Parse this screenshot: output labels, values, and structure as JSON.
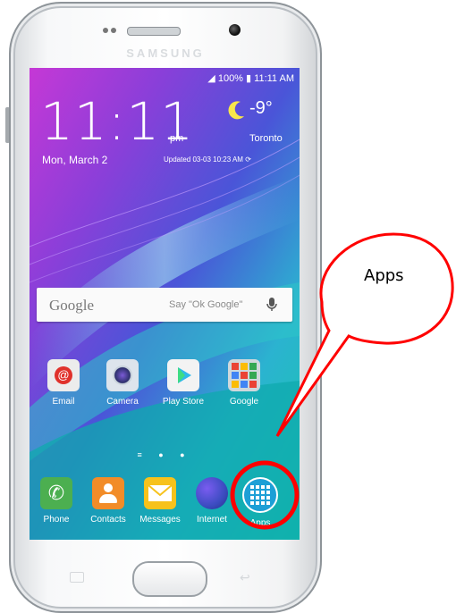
{
  "device": {
    "brand": "SAMSUNG"
  },
  "status_bar": {
    "battery": "100%",
    "time": "11:11 AM"
  },
  "lock_widget": {
    "time": "11:11",
    "ampm": "pm",
    "date": "Mon, March 2",
    "temperature": "-9°",
    "city": "Toronto",
    "updated": "Updated 03-03 10:23 AM"
  },
  "google_bar": {
    "logo": "Google",
    "hint": "Say \"Ok Google\""
  },
  "apps": [
    {
      "label": "Email",
      "icon": "email-icon",
      "color": "#e8e8e8"
    },
    {
      "label": "Camera",
      "icon": "camera-icon",
      "color": "#dfe6ee"
    },
    {
      "label": "Play Store",
      "icon": "play-store-icon",
      "color": "#f2f2f2"
    },
    {
      "label": "Google",
      "icon": "google-folder-icon",
      "color": "#cfd8dc"
    }
  ],
  "dock": [
    {
      "label": "Phone",
      "icon": "phone-icon",
      "color": "#4caf50"
    },
    {
      "label": "Contacts",
      "icon": "contacts-icon",
      "color": "#f28c28"
    },
    {
      "label": "Messages",
      "icon": "messages-icon",
      "color": "#f7c21b"
    },
    {
      "label": "Internet",
      "icon": "internet-icon",
      "color": "#3b4cc0"
    },
    {
      "label": "Apps",
      "icon": "apps-grid-icon",
      "color": "#1d9fd6"
    }
  ],
  "callout": {
    "label": "Apps",
    "highlight_color": "#ff0000"
  }
}
